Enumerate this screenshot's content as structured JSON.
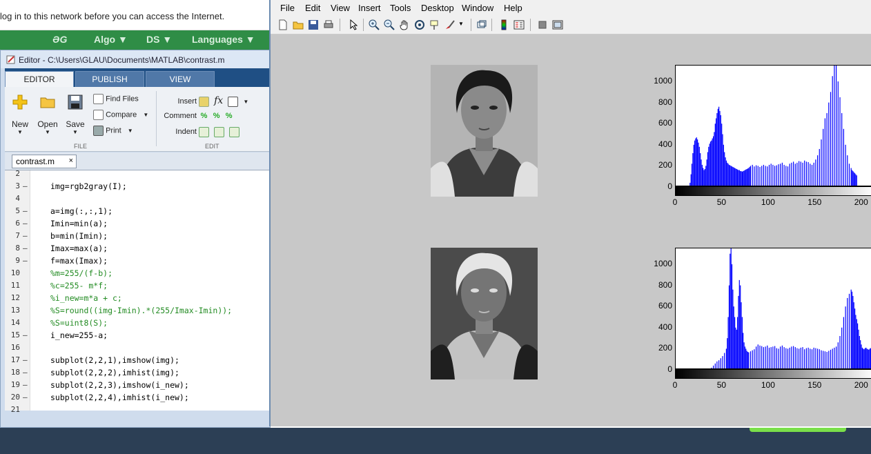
{
  "browser": {
    "notice": "log in to this network before you can access the Internet."
  },
  "gfg_nav": {
    "logo": "ƏG",
    "items": [
      "Algo ▼",
      "DS ▼",
      "Languages ▼"
    ]
  },
  "editor": {
    "title": "Editor - C:\\Users\\GLAU\\Documents\\MATLAB\\contrast.m",
    "tabs": [
      "EDITOR",
      "PUBLISH",
      "VIEW"
    ],
    "ribbon": {
      "new": "New",
      "open": "Open",
      "save": "Save",
      "find_files": "Find Files",
      "compare": "Compare",
      "print": "Print",
      "insert": "Insert",
      "comment": "Comment",
      "indent": "Indent",
      "group_file": "FILE",
      "group_edit": "EDIT",
      "fx": "fx"
    },
    "doc_tab": "contrast.m",
    "doc_tab_close": "×",
    "lines": [
      {
        "n": "2",
        "dash": "",
        "code": "",
        "comment": false
      },
      {
        "n": "3",
        "dash": "–",
        "code": "img=rgb2gray(I);",
        "comment": false
      },
      {
        "n": "4",
        "dash": "",
        "code": "",
        "comment": false
      },
      {
        "n": "5",
        "dash": "–",
        "code": "a=img(:,:,1);",
        "comment": false
      },
      {
        "n": "6",
        "dash": "–",
        "code": "Imin=min(a);",
        "comment": false
      },
      {
        "n": "7",
        "dash": "–",
        "code": "b=min(Imin);",
        "comment": false
      },
      {
        "n": "8",
        "dash": "–",
        "code": "Imax=max(a);",
        "comment": false
      },
      {
        "n": "9",
        "dash": "–",
        "code": "f=max(Imax);",
        "comment": false
      },
      {
        "n": "10",
        "dash": "",
        "code": "%m=255/(f-b);",
        "comment": true
      },
      {
        "n": "11",
        "dash": "",
        "code": "%c=255- m*f;",
        "comment": true
      },
      {
        "n": "12",
        "dash": "",
        "code": "%i_new=m*a + c;",
        "comment": true
      },
      {
        "n": "13",
        "dash": "",
        "code": "%S=round((img-Imin).*(255/Imax-Imin));",
        "comment": true
      },
      {
        "n": "14",
        "dash": "",
        "code": "%S=uint8(S);",
        "comment": true
      },
      {
        "n": "15",
        "dash": "–",
        "code": "i_new=255-a;",
        "comment": false
      },
      {
        "n": "16",
        "dash": "",
        "code": "",
        "comment": false
      },
      {
        "n": "17",
        "dash": "–",
        "code": "subplot(2,2,1),imshow(img);",
        "comment": false
      },
      {
        "n": "18",
        "dash": "–",
        "code": "subplot(2,2,2),imhist(img);",
        "comment": false
      },
      {
        "n": "19",
        "dash": "–",
        "code": "subplot(2,2,3),imshow(i_new);",
        "comment": false
      },
      {
        "n": "20",
        "dash": "–",
        "code": "subplot(2,2,4),imhist(i_new);",
        "comment": false
      },
      {
        "n": "21",
        "dash": "",
        "code": "",
        "comment": false
      }
    ]
  },
  "figure": {
    "menu": [
      "File",
      "Edit",
      "View",
      "Insert",
      "Tools",
      "Desktop",
      "Window",
      "Help"
    ],
    "toolbar_icons": [
      "new-figure-icon",
      "open-icon",
      "save-icon",
      "print-icon",
      "pointer-icon",
      "zoom-in-icon",
      "zoom-out-icon",
      "pan-icon",
      "rotate-icon",
      "data-cursor-icon",
      "brush-icon",
      "link-icon",
      "colorbar-icon",
      "legend-icon",
      "hide-plot-tools-icon",
      "show-plot-tools-icon"
    ]
  },
  "chart_data": [
    {
      "type": "bar",
      "title": "",
      "xlabel": "",
      "ylabel": "",
      "xlim": [
        0,
        215
      ],
      "ylim": [
        0,
        1150
      ],
      "xticks": [
        "0",
        "50",
        "100",
        "150",
        "200"
      ],
      "yticks": [
        "0",
        "200",
        "400",
        "600",
        "800",
        "1000"
      ],
      "color": "#0000ff",
      "x": [
        15,
        16,
        17,
        18,
        19,
        20,
        21,
        22,
        23,
        24,
        25,
        26,
        27,
        28,
        29,
        30,
        31,
        32,
        33,
        34,
        35,
        36,
        37,
        38,
        39,
        40,
        41,
        42,
        43,
        44,
        45,
        46,
        47,
        48,
        49,
        50,
        51,
        52,
        53,
        54,
        55,
        56,
        57,
        58,
        59,
        60,
        61,
        62,
        63,
        64,
        65,
        66,
        67,
        68,
        69,
        70,
        71,
        72,
        73,
        74,
        75,
        76,
        77,
        78,
        79,
        80,
        82,
        84,
        86,
        88,
        90,
        92,
        94,
        96,
        98,
        100,
        102,
        104,
        106,
        108,
        110,
        112,
        114,
        116,
        118,
        120,
        122,
        124,
        126,
        128,
        130,
        132,
        134,
        136,
        138,
        140,
        142,
        144,
        146,
        148,
        150,
        152,
        154,
        156,
        158,
        160,
        162,
        164,
        166,
        168,
        170,
        172,
        174,
        176,
        178,
        180,
        182,
        184,
        186,
        188,
        189,
        190,
        191,
        192,
        193,
        194,
        195,
        196,
        197,
        198,
        199,
        200,
        201,
        202,
        203,
        204,
        205,
        206,
        207,
        208,
        209,
        210
      ],
      "values": [
        40,
        120,
        220,
        320,
        400,
        440,
        460,
        470,
        450,
        420,
        380,
        320,
        260,
        210,
        180,
        160,
        170,
        200,
        260,
        330,
        380,
        410,
        430,
        440,
        460,
        480,
        520,
        600,
        650,
        700,
        740,
        760,
        720,
        680,
        600,
        500,
        400,
        330,
        280,
        250,
        230,
        220,
        210,
        205,
        200,
        195,
        190,
        185,
        180,
        175,
        170,
        165,
        160,
        160,
        150,
        150,
        145,
        150,
        155,
        160,
        165,
        170,
        175,
        180,
        190,
        200,
        210,
        195,
        205,
        200,
        190,
        200,
        210,
        200,
        195,
        210,
        220,
        210,
        200,
        205,
        215,
        220,
        230,
        210,
        200,
        195,
        220,
        230,
        240,
        220,
        230,
        245,
        240,
        230,
        250,
        240,
        235,
        220,
        210,
        230,
        260,
        300,
        360,
        450,
        550,
        650,
        700,
        800,
        900,
        1050,
        1150,
        1150,
        1000,
        850,
        700,
        550,
        400,
        300,
        220,
        180,
        160,
        150,
        140,
        130,
        120,
        110
      ]
    },
    {
      "type": "bar",
      "title": "",
      "xlabel": "",
      "ylabel": "",
      "xlim": [
        0,
        215
      ],
      "ylim": [
        0,
        1150
      ],
      "xticks": [
        "0",
        "50",
        "100",
        "150",
        "200"
      ],
      "yticks": [
        "0",
        "200",
        "400",
        "600",
        "800",
        "1000"
      ],
      "color": "#0000ff",
      "x": [
        38,
        40,
        42,
        44,
        46,
        48,
        50,
        52,
        54,
        55,
        56,
        57,
        58,
        59,
        60,
        61,
        62,
        63,
        64,
        65,
        66,
        67,
        68,
        69,
        70,
        71,
        72,
        73,
        74,
        75,
        76,
        77,
        78,
        80,
        82,
        84,
        86,
        88,
        90,
        92,
        94,
        96,
        98,
        100,
        102,
        104,
        106,
        108,
        110,
        112,
        114,
        116,
        118,
        120,
        122,
        124,
        126,
        128,
        130,
        132,
        134,
        136,
        138,
        140,
        142,
        144,
        146,
        148,
        150,
        152,
        154,
        156,
        158,
        160,
        162,
        164,
        166,
        168,
        170,
        172,
        174,
        176,
        178,
        180,
        182,
        184,
        186,
        188,
        189,
        190,
        191,
        192,
        193,
        194,
        195,
        196,
        197,
        198,
        199,
        200,
        201,
        202,
        203,
        204,
        205,
        206,
        207,
        208,
        209,
        210,
        211
      ],
      "values": [
        20,
        40,
        60,
        80,
        90,
        110,
        130,
        160,
        200,
        300,
        500,
        800,
        1100,
        1150,
        1000,
        760,
        600,
        500,
        400,
        380,
        500,
        700,
        850,
        800,
        640,
        500,
        350,
        260,
        220,
        200,
        180,
        170,
        165,
        175,
        185,
        195,
        220,
        240,
        230,
        225,
        215,
        220,
        230,
        210,
        215,
        220,
        225,
        205,
        200,
        220,
        230,
        215,
        205,
        200,
        210,
        220,
        225,
        215,
        205,
        200,
        210,
        215,
        195,
        205,
        210,
        200,
        195,
        210,
        205,
        200,
        195,
        185,
        180,
        175,
        170,
        180,
        190,
        200,
        210,
        220,
        260,
        320,
        400,
        500,
        600,
        680,
        720,
        760,
        740,
        700,
        640,
        580,
        520,
        480,
        440,
        380,
        320,
        280,
        240,
        210,
        200,
        195,
        205,
        210,
        200,
        195,
        190,
        200,
        205,
        210,
        200
      ]
    }
  ]
}
